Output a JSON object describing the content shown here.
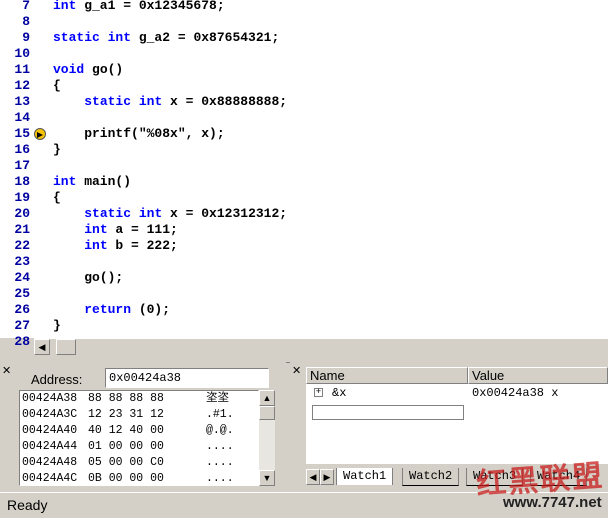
{
  "editor": {
    "lines": [
      {
        "n": "7",
        "parts": [
          {
            "t": "int",
            "k": true
          },
          {
            "t": " g_a1 = 0x12345678;"
          }
        ]
      },
      {
        "n": "8",
        "parts": []
      },
      {
        "n": "9",
        "parts": [
          {
            "t": "static",
            "k": true
          },
          {
            "t": " "
          },
          {
            "t": "int",
            "k": true
          },
          {
            "t": " g_a2 = 0x87654321;"
          }
        ]
      },
      {
        "n": "10",
        "parts": []
      },
      {
        "n": "11",
        "parts": [
          {
            "t": "void",
            "k": true
          },
          {
            "t": " go()"
          }
        ]
      },
      {
        "n": "12",
        "parts": [
          {
            "t": "{"
          }
        ]
      },
      {
        "n": "13",
        "parts": [
          {
            "t": "    "
          },
          {
            "t": "static",
            "k": true
          },
          {
            "t": " "
          },
          {
            "t": "int",
            "k": true
          },
          {
            "t": " x = 0x88888888;"
          }
        ]
      },
      {
        "n": "14",
        "parts": []
      },
      {
        "n": "15",
        "parts": [
          {
            "t": "    printf(\"%08x\", x);"
          }
        ],
        "breakpoint": true
      },
      {
        "n": "16",
        "parts": [
          {
            "t": "}"
          }
        ]
      },
      {
        "n": "17",
        "parts": []
      },
      {
        "n": "18",
        "parts": [
          {
            "t": "int",
            "k": true
          },
          {
            "t": " main()"
          }
        ]
      },
      {
        "n": "19",
        "parts": [
          {
            "t": "{"
          }
        ]
      },
      {
        "n": "20",
        "parts": [
          {
            "t": "    "
          },
          {
            "t": "static",
            "k": true
          },
          {
            "t": " "
          },
          {
            "t": "int",
            "k": true
          },
          {
            "t": " x = 0x12312312;"
          }
        ]
      },
      {
        "n": "21",
        "parts": [
          {
            "t": "    "
          },
          {
            "t": "int",
            "k": true
          },
          {
            "t": " a = 111;"
          }
        ]
      },
      {
        "n": "22",
        "parts": [
          {
            "t": "    "
          },
          {
            "t": "int",
            "k": true
          },
          {
            "t": " b = 222;"
          }
        ]
      },
      {
        "n": "23",
        "parts": []
      },
      {
        "n": "24",
        "parts": [
          {
            "t": "    go();"
          }
        ]
      },
      {
        "n": "25",
        "parts": []
      },
      {
        "n": "26",
        "parts": [
          {
            "t": "    "
          },
          {
            "t": "return",
            "k": true
          },
          {
            "t": " (0);"
          }
        ]
      },
      {
        "n": "27",
        "parts": [
          {
            "t": "}"
          }
        ]
      },
      {
        "n": "28",
        "parts": []
      }
    ],
    "keyword_color": "#0000ff",
    "line_number_color": "#0000a0"
  },
  "memory": {
    "address_label": "Address:",
    "address_value": "0x00424a38",
    "rows": [
      {
        "addr": "00424A38",
        "bytes": "88 88 88 88",
        "ascii": "垐垐"
      },
      {
        "addr": "00424A3C",
        "bytes": "12 23 31 12",
        "ascii": ".#1."
      },
      {
        "addr": "00424A40",
        "bytes": "40 12 40 00",
        "ascii": "@.@."
      },
      {
        "addr": "00424A44",
        "bytes": "01 00 00 00",
        "ascii": "...."
      },
      {
        "addr": "00424A48",
        "bytes": "05 00 00 C0",
        "ascii": "...."
      },
      {
        "addr": "00424A4C",
        "bytes": "0B 00 00 00",
        "ascii": "...."
      }
    ]
  },
  "watch": {
    "headers": {
      "name": "Name",
      "value": "Value"
    },
    "rows": [
      {
        "expander": "+",
        "name": "&x",
        "value": "0x00424a38 x"
      }
    ],
    "tabs": [
      "Watch1",
      "Watch2",
      "Watch3",
      "Watch4"
    ],
    "active_tab": 0
  },
  "status": {
    "text": "Ready"
  },
  "watermark": {
    "brand": "红黑联盟",
    "url": "www.7747.net"
  }
}
